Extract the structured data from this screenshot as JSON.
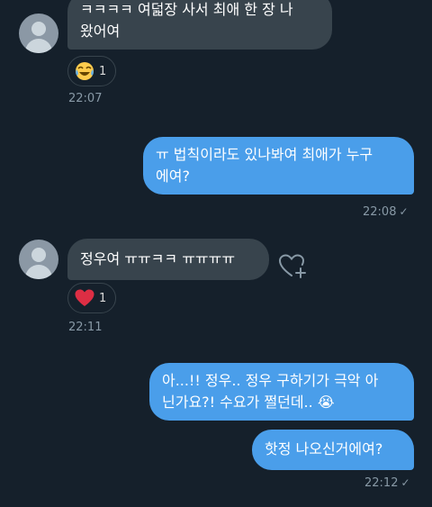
{
  "messages": [
    {
      "id": "m1",
      "direction": "incoming",
      "text": "ㅋㅋㅋㅋ 여덟장 사서 최애 한 장 나\n왔어여",
      "reaction": {
        "emoji": "joy-face",
        "count": "1"
      },
      "time": "22:07"
    },
    {
      "id": "m2",
      "direction": "outgoing",
      "text": "ㅠ 법칙이라도 있나봐여 최애가 누구\n에여?",
      "time": "22:08",
      "read_icon": "check-icon"
    },
    {
      "id": "m3",
      "direction": "incoming",
      "text": "정우여 ㅠㅠㅋㅋ ㅠㅠㅠㅠ",
      "reaction": {
        "emoji": "red-heart",
        "count": "1"
      },
      "time": "22:11",
      "action_icon": "add-reaction-icon"
    },
    {
      "id": "m4",
      "direction": "outgoing",
      "text": "아...!! 정우.. 정우 구하기가 극악 아\n닌가요?! 수요가 쩔던데.. 😭"
    },
    {
      "id": "m5",
      "direction": "outgoing",
      "text": "핫정 나오신거에여?",
      "time": "22:12",
      "read_icon": "check-icon"
    }
  ],
  "colors": {
    "background": "#15202b",
    "incoming_bubble": "#38444d",
    "outgoing_bubble": "#4a9eea",
    "timestamp": "#8899a6"
  }
}
